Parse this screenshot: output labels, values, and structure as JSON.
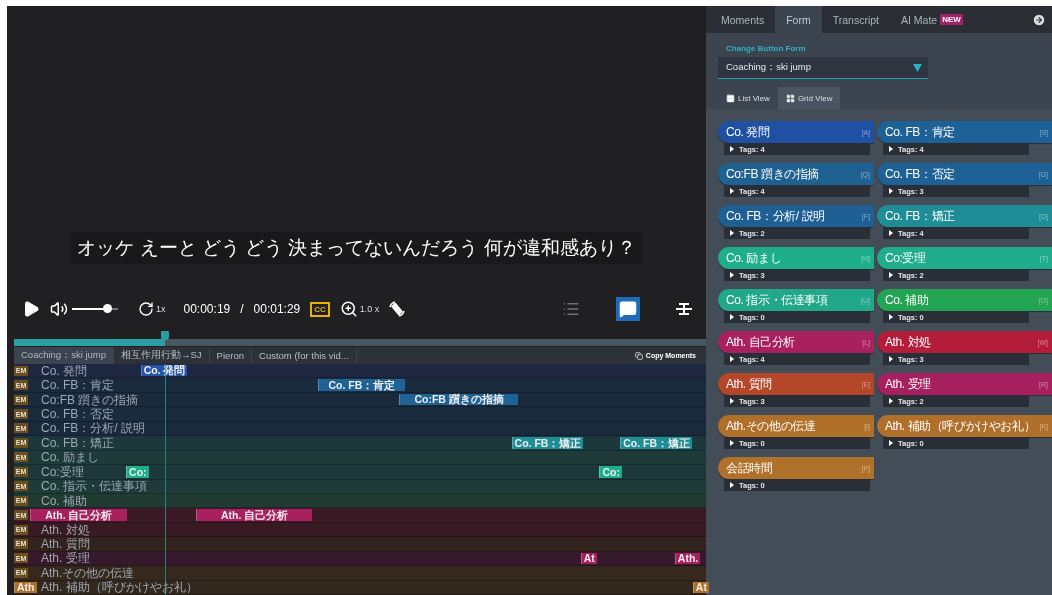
{
  "video": {
    "subtitle": "オッケ えーと どう どう 決まってないんだろう 何が違和感あり？"
  },
  "controls": {
    "volume": {
      "level": 0.75
    },
    "speed": "1x",
    "current_time": "00:00:19",
    "separator": "/",
    "duration": "00:01:29",
    "cc": "CC",
    "zoom": "1.0 x",
    "toggles": [
      {
        "kind": "list",
        "on": false
      },
      {
        "kind": "comment",
        "on": true
      },
      {
        "kind": "align",
        "on": false
      }
    ]
  },
  "timeline": {
    "progress": {
      "level": 0.218
    },
    "tabs": [
      {
        "label": "Coaching：ski jump",
        "selected": true
      },
      {
        "label": "相互作用行動→SJ",
        "selected": false
      },
      {
        "label": "Pieron",
        "selected": false
      },
      {
        "label": "Custom (for this vid...",
        "selected": false
      }
    ],
    "copy_button": "Copy Moments",
    "rows": [
      {
        "badge": "EM",
        "label": "Co. 発問",
        "color": "#1e2840",
        "segments": [
          {
            "label": "Co. 発問",
            "color": "#2455a8"
          }
        ]
      },
      {
        "badge": "EM",
        "label": "Co. FB：肯定",
        "color": "#1b2b3e",
        "segments": [
          {
            "label": "Co. FB：肯定",
            "color": "#1f6296"
          }
        ]
      },
      {
        "badge": "EM",
        "label": "Co:FB 躓きの指摘",
        "color": "#1a2a3c",
        "segments": [
          {
            "label": "Co:FB 躓きの指摘",
            "color": "#1f6296"
          }
        ]
      },
      {
        "badge": "EM",
        "label": "Co. FB：否定",
        "color": "#1b2b3e",
        "segments": []
      },
      {
        "badge": "EM",
        "label": "Co. FB：分析/ 説明",
        "color": "#1a2a3c",
        "segments": []
      },
      {
        "badge": "EM",
        "label": "Co. FB：矯正",
        "color": "#1d383c",
        "segments": [
          {
            "label": "Co. FB：矯正",
            "color": "#1f8d95"
          },
          {
            "label": "Co. FB：矯正",
            "color": "#1f8d95"
          }
        ]
      },
      {
        "badge": "EM",
        "label": "Co. 励まし",
        "color": "#1e3b3a",
        "segments": []
      },
      {
        "badge": "EM",
        "label": "Co:受理",
        "color": "#1d383a",
        "segments": [
          {
            "label": "Co:",
            "color": "#1fad8a"
          },
          {
            "label": "Co:",
            "color": "#1fad8a"
          }
        ]
      },
      {
        "badge": "EM",
        "label": "Co. 指示・伝達事項",
        "color": "#1e3b3a",
        "segments": []
      },
      {
        "badge": "EM",
        "label": "Co. 補助",
        "color": "#213a32",
        "segments": []
      },
      {
        "badge": "EM",
        "color": "#3b1a26",
        "segments": [
          {
            "label": "Ath. 自己分析",
            "color": "#a8205e"
          },
          {
            "label": "Ath. 自己分析",
            "color": "#a8205e"
          }
        ]
      },
      {
        "badge": "EM",
        "label": "Ath. 対処",
        "color": "#371a22",
        "segments": []
      },
      {
        "badge": "EM",
        "label": "Ath. 質問",
        "color": "#33231e",
        "segments": []
      },
      {
        "badge": "EM",
        "label": "Ath. 受理",
        "color": "#361a2b",
        "segments": [
          {
            "label": "At",
            "color": "#a61f5e"
          },
          {
            "label": "Ath.",
            "color": "#a61f5e"
          }
        ]
      },
      {
        "badge": "EM",
        "label": "Ath.その他の伝達",
        "color": "#35291e",
        "segments": []
      },
      {
        "label": "Ath. 補助（呼びかけやお礼）",
        "color": "#33281d",
        "segments": [
          {
            "label": "Ath",
            "color": "#b0702a"
          },
          {
            "label": "At",
            "color": "#b0702a"
          }
        ]
      }
    ]
  },
  "panel": {
    "tabs": [
      {
        "label": "Moments",
        "selected": false
      },
      {
        "label": "Form",
        "selected": true
      },
      {
        "label": "Transcript",
        "selected": false
      },
      {
        "label": "AI Mate",
        "selected": false,
        "badge": "NEW"
      }
    ],
    "form_label": "Change Button Form",
    "form_select": {
      "value": "Coaching：ski jump"
    },
    "view_tabs": [
      {
        "label": "List View",
        "kind": "list",
        "selected": false
      },
      {
        "label": "Grid View",
        "kind": "grid",
        "selected": true
      }
    ],
    "buttons": [
      {
        "label": "Co. 発問",
        "key": "[A]",
        "tags": "Tags: 4",
        "color": "#2050a4"
      },
      {
        "label": "Co. FB：肯定",
        "key": "[S]",
        "tags": "Tags: 4",
        "color": "#1e6196"
      },
      {
        "label": "Co:FB 躓きの指摘",
        "key": "[Q]",
        "tags": "Tags: 4",
        "color": "#1f6191"
      },
      {
        "label": "Co. FB：否定",
        "key": "[G]",
        "tags": "Tags: 3",
        "color": "#1e6197"
      },
      {
        "label": "Co. FB：分析/ 説明",
        "key": "[F]",
        "tags": "Tags: 2",
        "color": "#1e6094"
      },
      {
        "label": "Co. FB：矯正",
        "key": "[D]",
        "tags": "Tags: 4",
        "color": "#1f8d95"
      },
      {
        "label": "Co. 励まし",
        "key": "[H]",
        "tags": "Tags: 3",
        "color": "#1fae8a"
      },
      {
        "label": "Co:受理",
        "key": "[T]",
        "tags": "Tags: 2",
        "color": "#1fad8b"
      },
      {
        "label": "Co. 指示・伝達事項",
        "key": "[U]",
        "tags": "Tags: 0",
        "color": "#20a889"
      },
      {
        "label": "Co. 補助",
        "key": "[O]",
        "tags": "Tags: 0",
        "color": "#22a452"
      },
      {
        "label": "Ath. 自己分析",
        "key": "[L]",
        "tags": "Tags: 4",
        "color": "#a8205e"
      },
      {
        "label": "Ath. 対処",
        "key": "[W]",
        "tags": "Tags: 3",
        "color": "#b31d3a"
      },
      {
        "label": "Ath. 質問",
        "key": "[E]",
        "tags": "Tags: 3",
        "color": "#b4462a"
      },
      {
        "label": "Ath. 受理",
        "key": "[R]",
        "tags": "Tags: 2",
        "color": "#a61f5f"
      },
      {
        "label": "Ath.その他の伝達",
        "key": "[I]",
        "tags": "Tags: 0",
        "color": "#b0702a"
      },
      {
        "label": "Ath. 補助（呼びかけやお礼）",
        "key": "[K]",
        "tags": "Tags: 0",
        "color": "#b0702b"
      },
      {
        "label": "会話時間",
        "key": "[P]",
        "tags": "Tags: 0",
        "color": "#b0712a"
      }
    ]
  }
}
